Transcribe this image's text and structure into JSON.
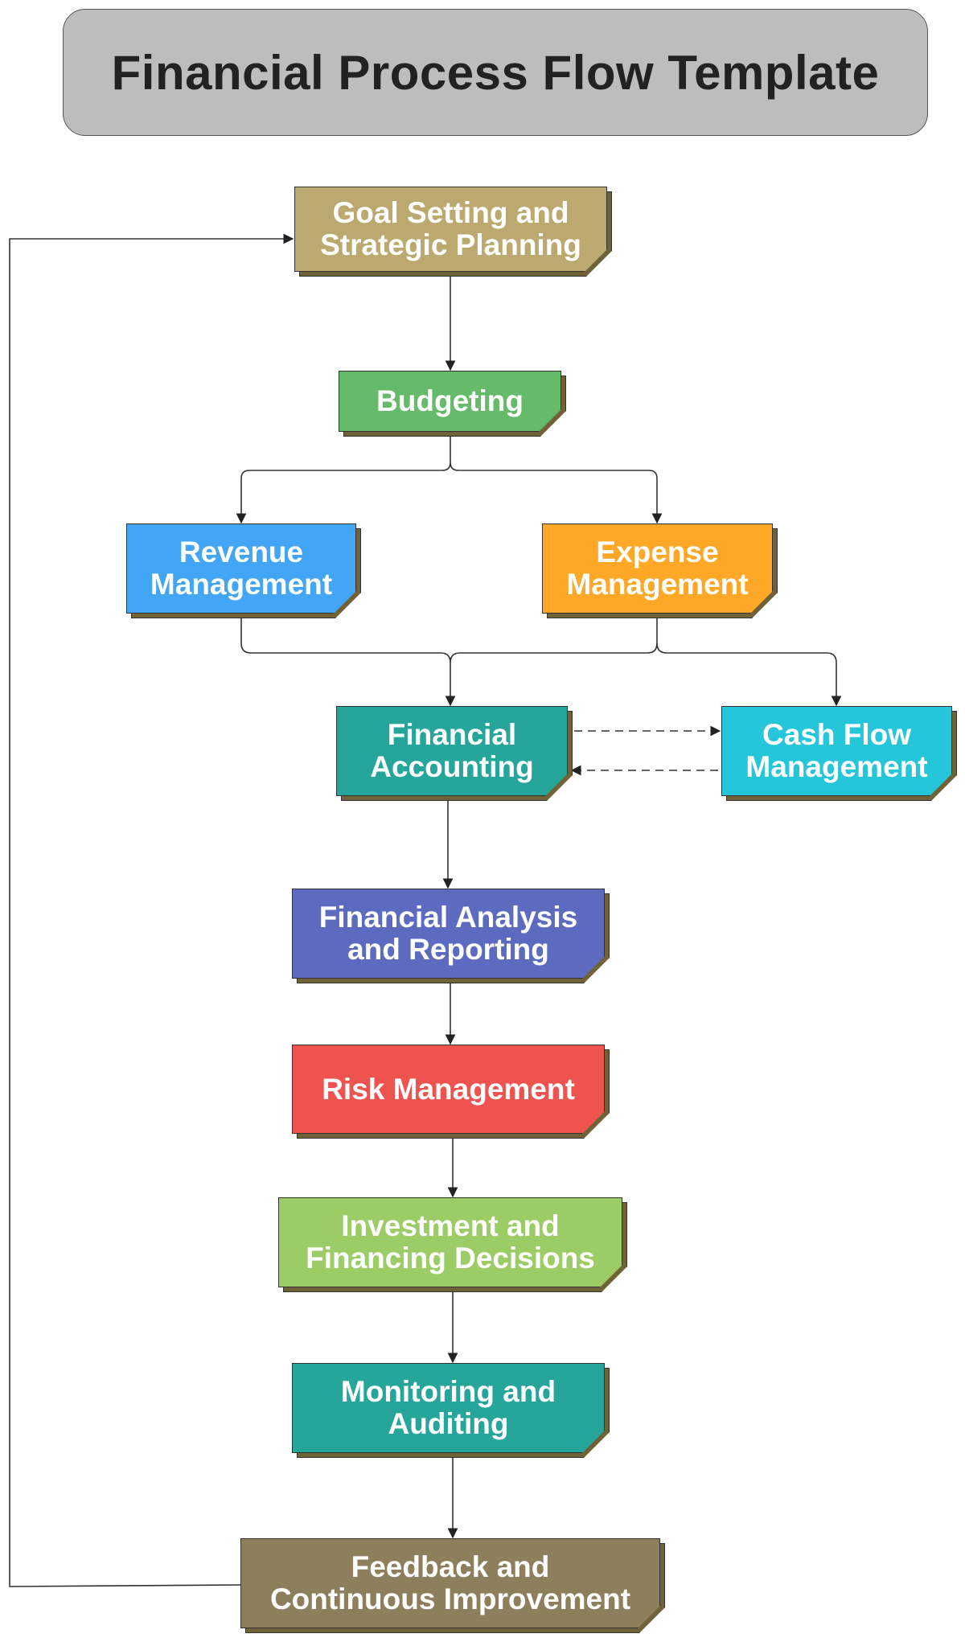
{
  "title": "Financial Process Flow Template",
  "nodes": [
    {
      "id": "goal",
      "label": "Goal Setting and\nStrategic Planning",
      "color": "#bca970"
    },
    {
      "id": "budget",
      "label": "Budgeting",
      "color": "#66bb6a"
    },
    {
      "id": "revenue",
      "label": "Revenue\nManagement",
      "color": "#42a5f5"
    },
    {
      "id": "expense",
      "label": "Expense\nManagement",
      "color": "#ffa726"
    },
    {
      "id": "accounting",
      "label": "Financial\nAccounting",
      "color": "#26a69a"
    },
    {
      "id": "cashflow",
      "label": "Cash Flow\nManagement",
      "color": "#26c6da"
    },
    {
      "id": "analysis",
      "label": "Financial Analysis\nand Reporting",
      "color": "#5c6bc0"
    },
    {
      "id": "risk",
      "label": "Risk Management",
      "color": "#ef5350"
    },
    {
      "id": "invest",
      "label": "Investment and\nFinancing Decisions",
      "color": "#9ccc65"
    },
    {
      "id": "monitor",
      "label": "Monitoring and\nAuditing",
      "color": "#26a69a"
    },
    {
      "id": "feedback",
      "label": "Feedback and\nContinuous Improvement",
      "color": "#8d7f5b"
    }
  ],
  "edges": [
    {
      "from": "goal",
      "to": "budget",
      "style": "solid"
    },
    {
      "from": "budget",
      "to": "revenue",
      "style": "solid"
    },
    {
      "from": "budget",
      "to": "expense",
      "style": "solid"
    },
    {
      "from": "revenue",
      "to": "accounting",
      "style": "solid"
    },
    {
      "from": "expense",
      "to": "accounting",
      "style": "solid"
    },
    {
      "from": "expense",
      "to": "cashflow",
      "style": "solid"
    },
    {
      "from": "accounting",
      "to": "cashflow",
      "style": "dashed"
    },
    {
      "from": "cashflow",
      "to": "accounting",
      "style": "dashed"
    },
    {
      "from": "accounting",
      "to": "analysis",
      "style": "solid"
    },
    {
      "from": "analysis",
      "to": "risk",
      "style": "solid"
    },
    {
      "from": "risk",
      "to": "invest",
      "style": "solid"
    },
    {
      "from": "invest",
      "to": "monitor",
      "style": "solid"
    },
    {
      "from": "monitor",
      "to": "feedback",
      "style": "solid"
    },
    {
      "from": "feedback",
      "to": "goal",
      "style": "solid"
    }
  ]
}
